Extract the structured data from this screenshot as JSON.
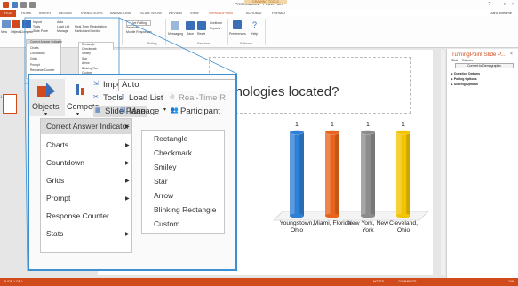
{
  "window": {
    "title": "Presentation1 - PowerPoint",
    "context_tab_group": "DRAWING TOOLS",
    "user": "Dana Brehme"
  },
  "tabs": [
    "FILE",
    "HOME",
    "INSERT",
    "DESIGN",
    "TRANSITIONS",
    "ANIMATIONS",
    "SLIDE SHOW",
    "REVIEW",
    "VIEW",
    "TURNINGPOINT",
    "ACROBAT",
    "FORMAT"
  ],
  "active_tab": "TURNINGPOINT",
  "ribbon": {
    "new_label": "New",
    "objects_label": "Objects",
    "compete_label": "Compete",
    "import_label": "Import",
    "tools_label": "Tools",
    "slide_pane_label": "Slide Pane",
    "auto_value": "Auto",
    "load_list_label": "Load List",
    "real_time_label": "Real-Time Registration",
    "manage_label": "Manage",
    "participant_monitor_label": "Participant Monitor",
    "live_polling_value": "Live Polling",
    "receiver_label": "Receiver",
    "mobile_responses_label": "Mobile Responses",
    "polling_group": "Polling",
    "continue_label": "Continue",
    "reports_label": "Reports",
    "preferences_label": "Preferences",
    "help_label": "Help",
    "sessions_group": "Sessions",
    "software_group": "Software",
    "messaging_label": "Messaging",
    "save_label": "Save",
    "reset_label": "Reset"
  },
  "small_menu": {
    "items": [
      "Correct Answer Indicator",
      "Charts",
      "Countdown",
      "Grids",
      "Prompt",
      "Response Counter",
      "Stats"
    ],
    "sub_items": [
      "Rectangle",
      "Checkmark",
      "Smiley",
      "Star",
      "Arrow",
      "Blinking Rectangle",
      "Custom"
    ]
  },
  "zoom": {
    "objects_label": "Objects",
    "compete_label": "Compete",
    "import_label": "Import",
    "tools_label": "Tools",
    "slide_pane_label": "Slide Pane",
    "auto_value": "Auto",
    "load_list_label": "Load List",
    "real_time_label": "Real-Time R",
    "manage_label": "Manage",
    "participant_label": "Participant",
    "menu_items": [
      "Correct Answer Indicator",
      "Charts",
      "Countdown",
      "Grids",
      "Prompt",
      "Response Counter",
      "Stats"
    ],
    "submenu_items": [
      "Rectangle",
      "Checkmark",
      "Smiley",
      "Star",
      "Arrow",
      "Blinking Rectangle",
      "Custom"
    ]
  },
  "slide": {
    "title": "Technologies located?",
    "thumb_number": "1"
  },
  "chart_data": {
    "type": "bar",
    "categories": [
      "Youngstown, Ohio",
      "Miami, Florida",
      "New York, New York",
      "Cleveland, Ohio"
    ],
    "values": [
      1,
      1,
      1,
      1
    ],
    "data_labels": [
      "1",
      "1",
      "1",
      "1"
    ],
    "colors": [
      "#2f7fd4",
      "#e8641c",
      "#8c8c8c",
      "#f3c400"
    ],
    "ylim": [
      0,
      1
    ],
    "grid": false,
    "legend": "none"
  },
  "task_pane": {
    "title": "TurningPoint Slide P...",
    "tab_slide": "Slide",
    "tab_objects": "Objects",
    "convert_button": "Convert to Demographic",
    "options": [
      "Question Options",
      "Polling Options",
      "Scoring Options"
    ]
  },
  "status": {
    "slide": "SLIDE 1 OF 1",
    "notes": "NOTES",
    "comments": "COMMENTS",
    "zoom": "74%"
  },
  "colors": {
    "accent": "#d04a1c",
    "zoom_border": "#3b8fd3"
  }
}
